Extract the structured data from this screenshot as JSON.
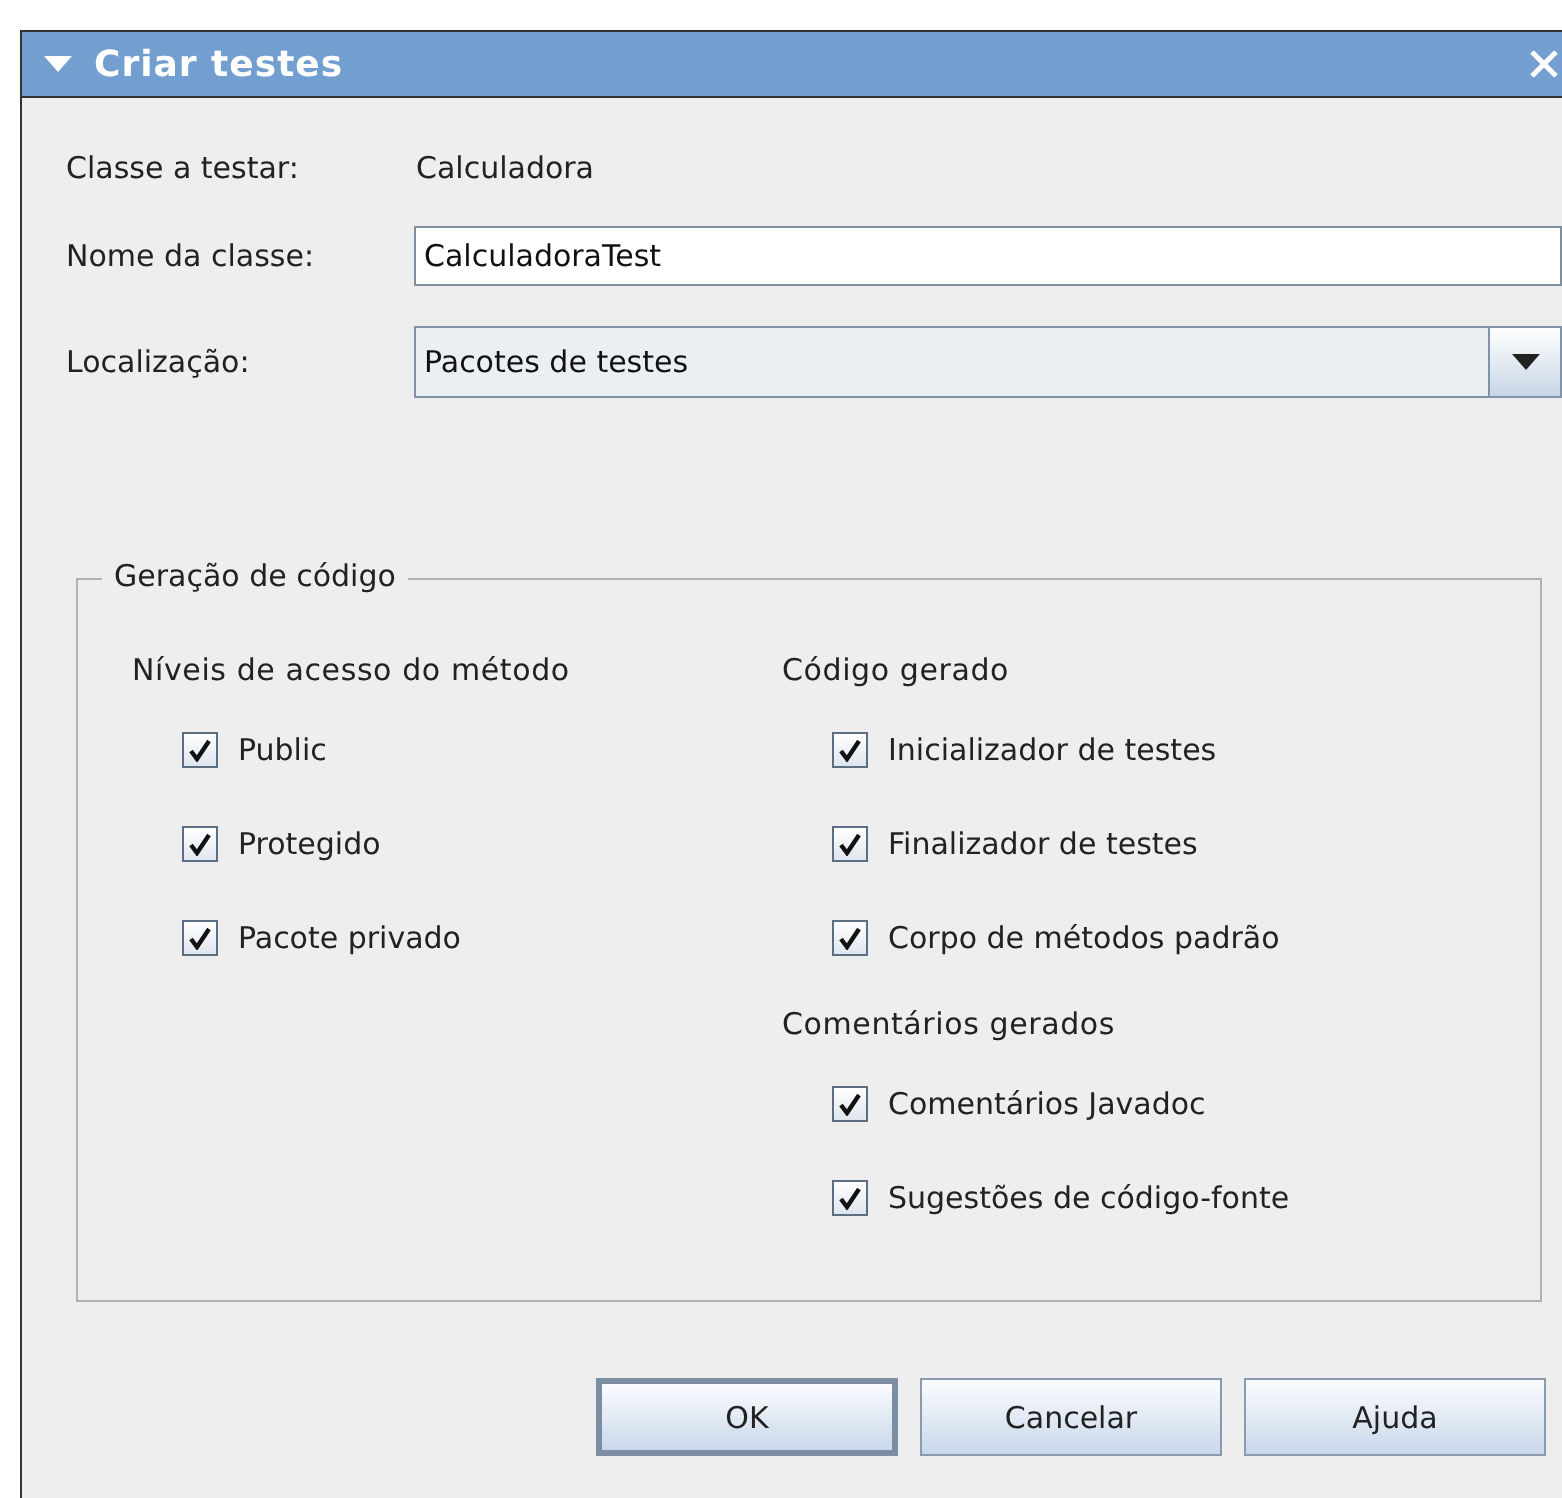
{
  "window": {
    "title": "Criar testes"
  },
  "fields": [
    {
      "kind": "text",
      "label": "Classe a testar:",
      "value": "Calculadora"
    },
    {
      "kind": "input",
      "label": "Nome da classe:",
      "value": "CalculadoraTest"
    },
    {
      "kind": "dropdown",
      "label": "Localização:",
      "value": "Pacotes de testes"
    }
  ],
  "group": {
    "title": "Geração de código",
    "columns": [
      {
        "sections": [
          {
            "heading": "Níveis de acesso do método",
            "options": [
              {
                "label": "Public",
                "checked": true
              },
              {
                "label": "Protegido",
                "checked": true
              },
              {
                "label": "Pacote privado",
                "checked": true
              }
            ]
          }
        ]
      },
      {
        "sections": [
          {
            "heading": "Código gerado",
            "options": [
              {
                "label": "Inicializador de testes",
                "checked": true
              },
              {
                "label": "Finalizador de testes",
                "checked": true
              },
              {
                "label": "Corpo de métodos padrão",
                "checked": true
              }
            ]
          },
          {
            "heading": "Comentários gerados",
            "options": [
              {
                "label": "Comentários Javadoc",
                "checked": true
              },
              {
                "label": "Sugestões de código-fonte",
                "checked": true
              }
            ]
          }
        ]
      }
    ]
  },
  "buttons": [
    {
      "label": "OK",
      "default": true
    },
    {
      "label": "Cancelar",
      "default": false
    },
    {
      "label": "Ajuda",
      "default": false
    }
  ]
}
